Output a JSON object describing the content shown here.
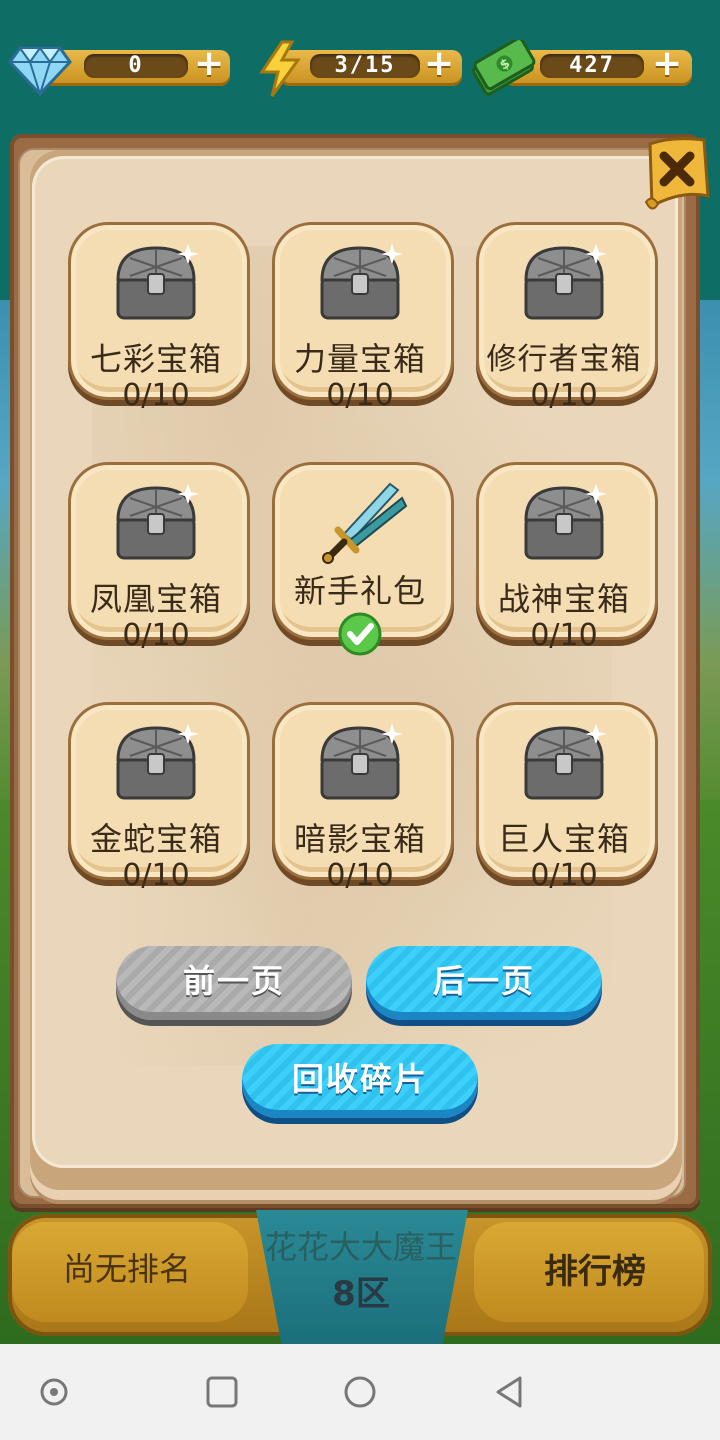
{
  "currencies": [
    {
      "id": "diamonds",
      "icon": "diamond-icon",
      "value": "0"
    },
    {
      "id": "energy",
      "icon": "lightning-icon",
      "value": "3/15"
    },
    {
      "id": "cash",
      "icon": "cash-icon",
      "value": "427"
    }
  ],
  "chests": [
    {
      "name": "七彩宝箱",
      "count": "0/10",
      "icon": "chest-icon"
    },
    {
      "name": "力量宝箱",
      "count": "0/10",
      "icon": "chest-icon"
    },
    {
      "name": "修行者宝箱",
      "count": "0/10",
      "icon": "chest-icon"
    },
    {
      "name": "凤凰宝箱",
      "count": "0/10",
      "icon": "chest-icon"
    },
    {
      "name": "新手礼包",
      "count": "",
      "icon": "sword-icon",
      "claimed": true
    },
    {
      "name": "战神宝箱",
      "count": "0/10",
      "icon": "chest-icon"
    },
    {
      "name": "金蛇宝箱",
      "count": "0/10",
      "icon": "chest-icon"
    },
    {
      "name": "暗影宝箱",
      "count": "0/10",
      "icon": "chest-icon"
    },
    {
      "name": "巨人宝箱",
      "count": "0/10",
      "icon": "chest-icon"
    }
  ],
  "buttons": {
    "prev": "前一页",
    "next": "后一页",
    "recycle": "回收碎片"
  },
  "ranking": {
    "status": "尚无排名",
    "player": "花花大大魔王",
    "zone": "8区",
    "leaderboard": "排行榜"
  },
  "colors": {
    "accent_blue": "#2fc2ef",
    "card_bg": "#f4ddb2",
    "panel_bg": "#ead7bb"
  }
}
